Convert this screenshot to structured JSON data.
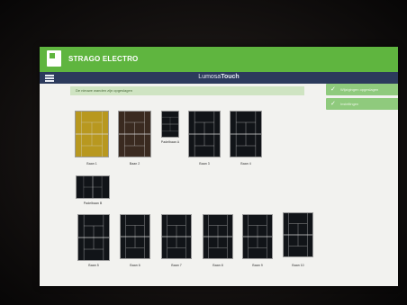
{
  "header": {
    "brand": "STRAGO ELECTRO",
    "brand_color": "#5fb53f"
  },
  "navbar": {
    "title_prefix": "Lumosa",
    "title_bold": "Touch",
    "color": "#2c3a5c"
  },
  "notice": {
    "text": "De nieuwe wanden zijn opgeslagen"
  },
  "toasts": [
    {
      "icon": "check-icon",
      "text": "Wijzigingen opgeslagen"
    },
    {
      "icon": "check-icon",
      "text": "Instellingen"
    }
  ],
  "courts": [
    {
      "label": "Baan 1",
      "color": "#b8981f"
    },
    {
      "label": "Baan 2",
      "color": "#3a2a20"
    },
    {
      "label": "Padelbaan A",
      "color": "#111418"
    },
    {
      "label": "Baan 3",
      "color": "#111418"
    },
    {
      "label": "Baan 4",
      "color": "#111418"
    },
    {
      "label": "Padelbaan B",
      "color": "#111418"
    },
    {
      "label": "Baan 5",
      "color": "#111418"
    },
    {
      "label": "Baan 6",
      "color": "#111418"
    },
    {
      "label": "Baan 7",
      "color": "#111418"
    },
    {
      "label": "Baan 8",
      "color": "#111418"
    },
    {
      "label": "Baan 9",
      "color": "#111418"
    },
    {
      "label": "Baan 10",
      "color": "#111418"
    }
  ]
}
